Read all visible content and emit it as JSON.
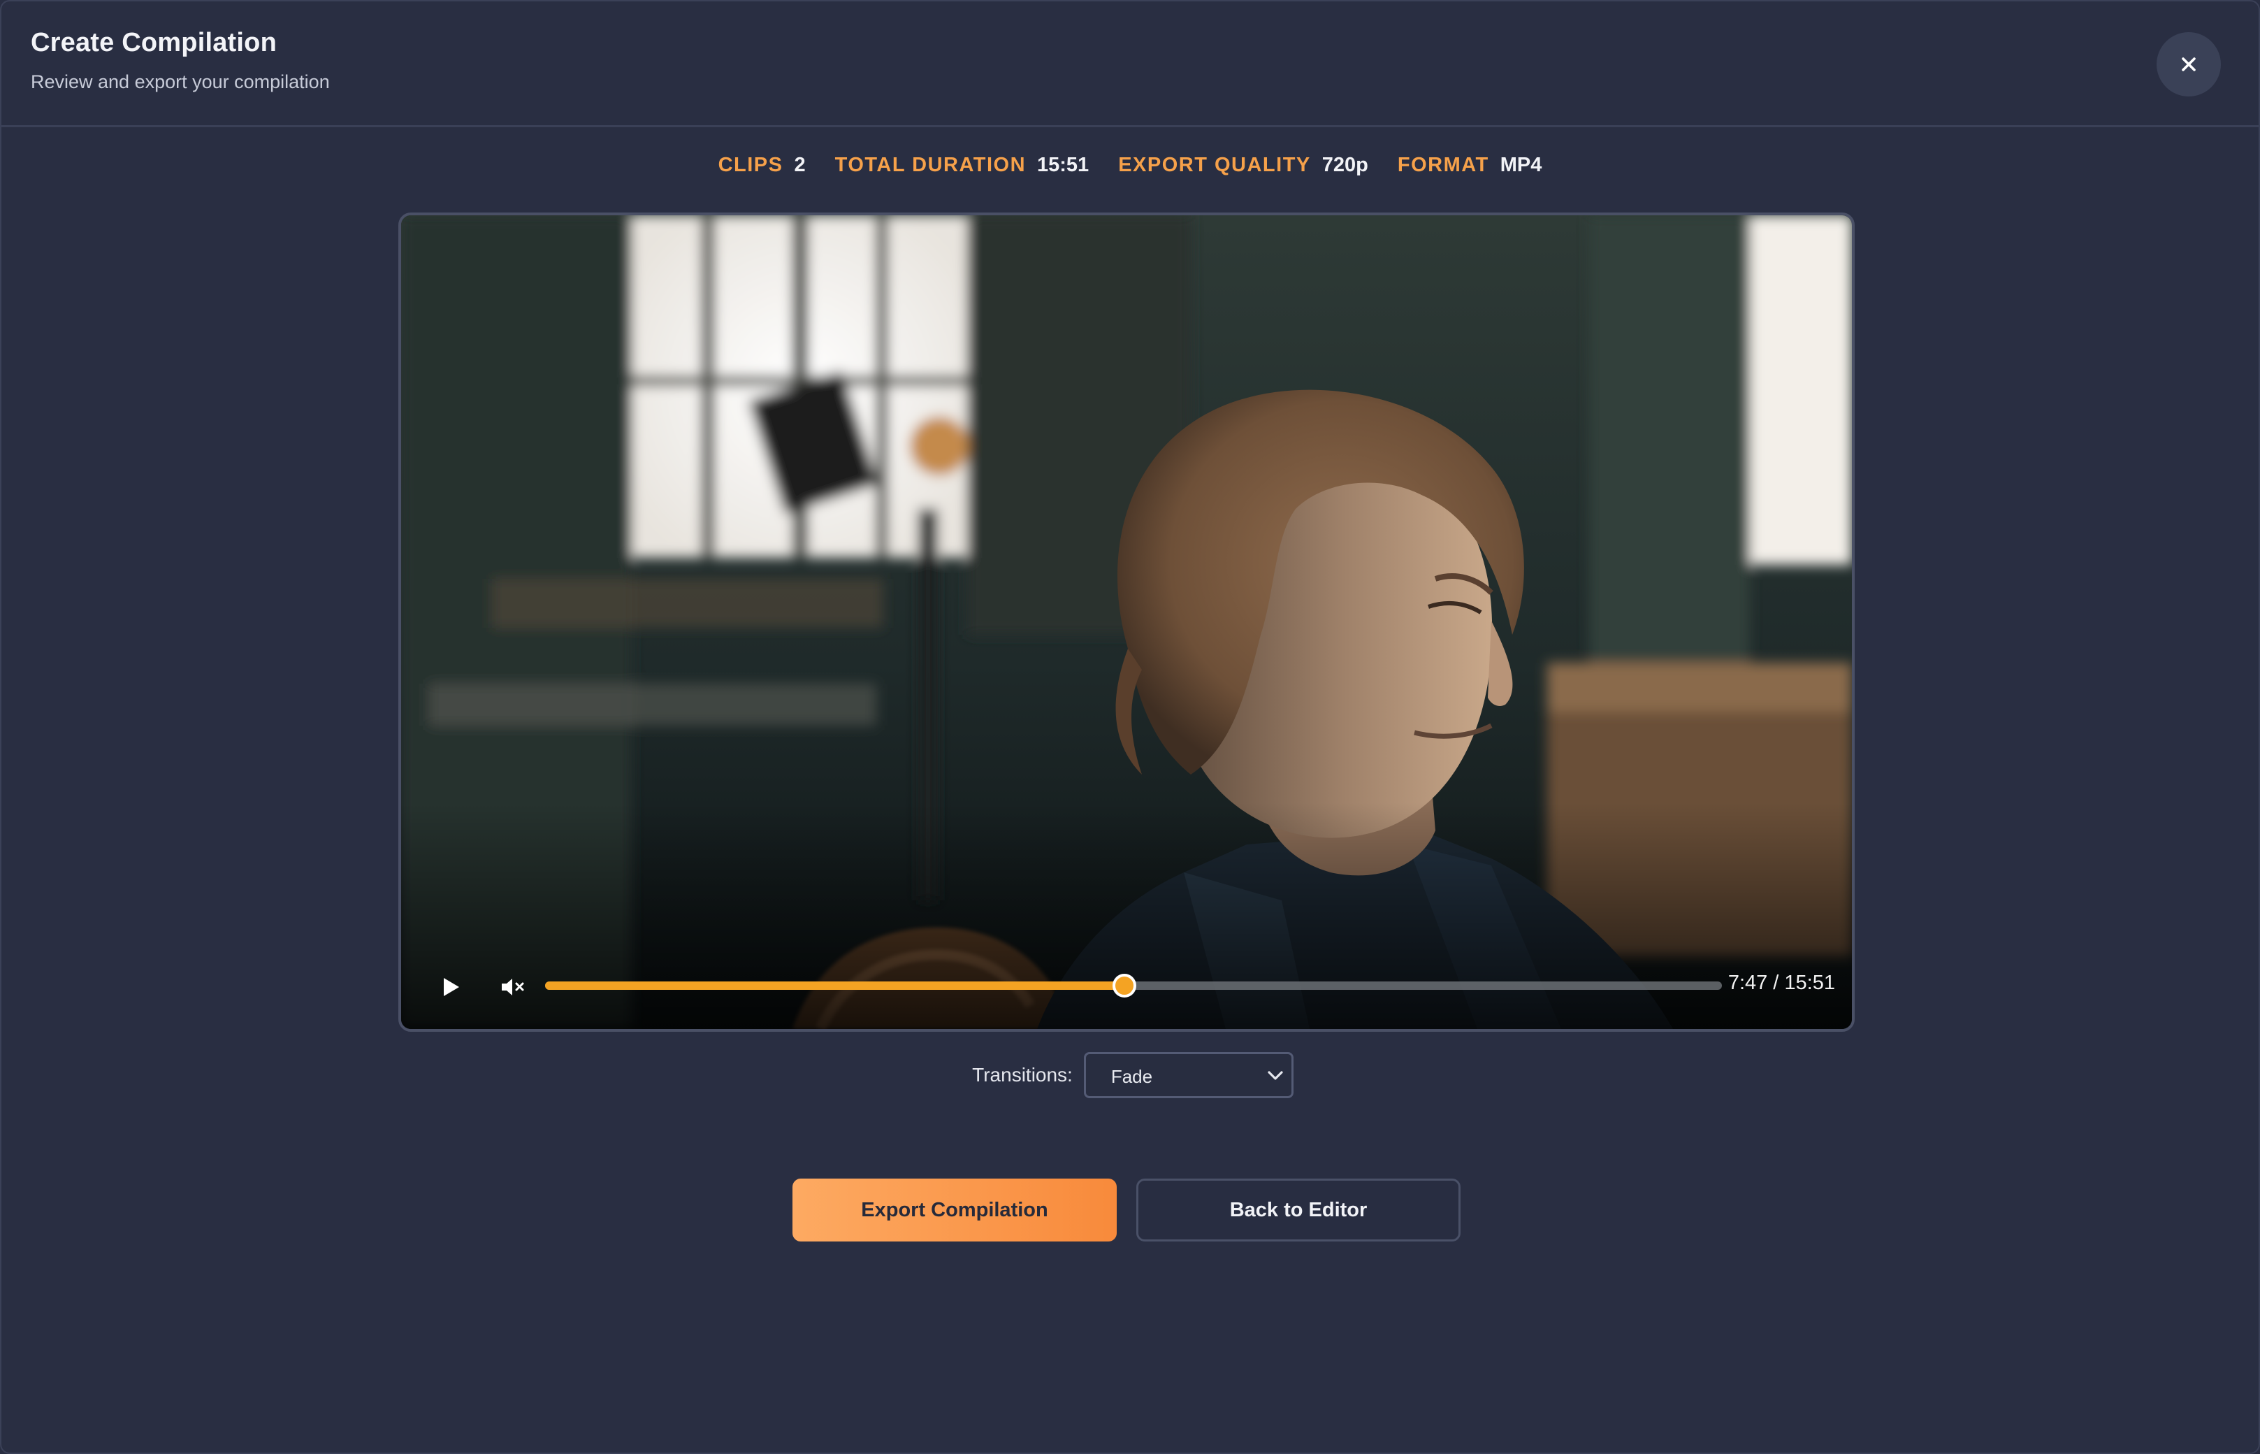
{
  "header": {
    "title": "Create Compilation",
    "subtitle": "Review and export your compilation",
    "close_icon": "close-icon"
  },
  "stats": [
    {
      "label": "CLIPS",
      "value": "2"
    },
    {
      "label": "TOTAL DURATION",
      "value": "15:51"
    },
    {
      "label": "EXPORT QUALITY",
      "value": "720p"
    },
    {
      "label": "FORMAT",
      "value": "MP4"
    }
  ],
  "player": {
    "play_icon": "play-icon",
    "mute_icon": "volume-muted-icon",
    "current_time": "7:47",
    "total_time": "15:51",
    "time_display": "7:47 / 15:51",
    "progress": 0.491
  },
  "transitions": {
    "label": "Transitions:",
    "selected": "Fade",
    "chevron_icon": "chevron-down-icon"
  },
  "actions": {
    "export_label": "Export Compilation",
    "back_label": "Back to Editor"
  },
  "colors": {
    "background": "#292e42",
    "accent": "#f6a14a",
    "progress": "#f4a323",
    "export_gradient_start": "#fdaa62",
    "export_gradient_end": "#f88a3b"
  }
}
